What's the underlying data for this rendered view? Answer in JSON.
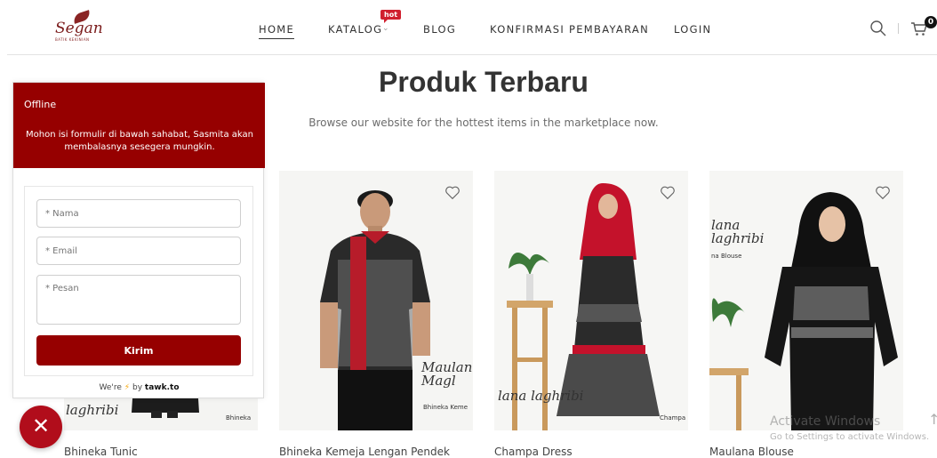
{
  "header": {
    "logo_text": "Segan",
    "logo_subtext": "BATIK KEKINIAN",
    "nav": [
      {
        "label": "HOME",
        "active": true
      },
      {
        "label": "KATALOG",
        "active": false
      },
      {
        "label": "BLOG",
        "active": false
      },
      {
        "label": "KONFIRMASI PEMBAYARAN",
        "active": false
      },
      {
        "label": "LOGIN",
        "active": false
      }
    ],
    "hot_badge": "hot",
    "cart_count": "0"
  },
  "section": {
    "title": "Produk Terbaru",
    "subtitle": "Browse our website for the hottest items in the marketplace now."
  },
  "products": [
    {
      "name": "Bhineka Tunic",
      "image_caption": "Bhineka",
      "script_text": "laghribi"
    },
    {
      "name": "Bhineka Kemeja Lengan Pendek",
      "image_caption": "Bhineka Keme",
      "script_text": "Maulan Magl"
    },
    {
      "name": "Champa Dress",
      "image_caption": "Champa",
      "script_text": "lana laghribi"
    },
    {
      "name": "Maulana Blouse",
      "image_caption": "na Blouse",
      "script_text": "lana laghribi"
    }
  ],
  "chat": {
    "status": "Offline",
    "message": "Mohon isi formulir di bawah sahabat, Sasmita akan membalasnya sesegera mungkin.",
    "name_placeholder": "* Nama",
    "email_placeholder": "* Email",
    "message_placeholder": "* Pesan",
    "send_label": "Kirim",
    "powered_prefix": "We're",
    "powered_by": "by",
    "powered_brand": "tawk.to",
    "close_label": "✕"
  },
  "watermark": {
    "title": "Activate Windows",
    "subtitle": "Go to Settings to activate Windows."
  },
  "colors": {
    "brand_red": "#960000",
    "fab_red": "#b10d1b",
    "hot_red": "#d01f2e"
  }
}
